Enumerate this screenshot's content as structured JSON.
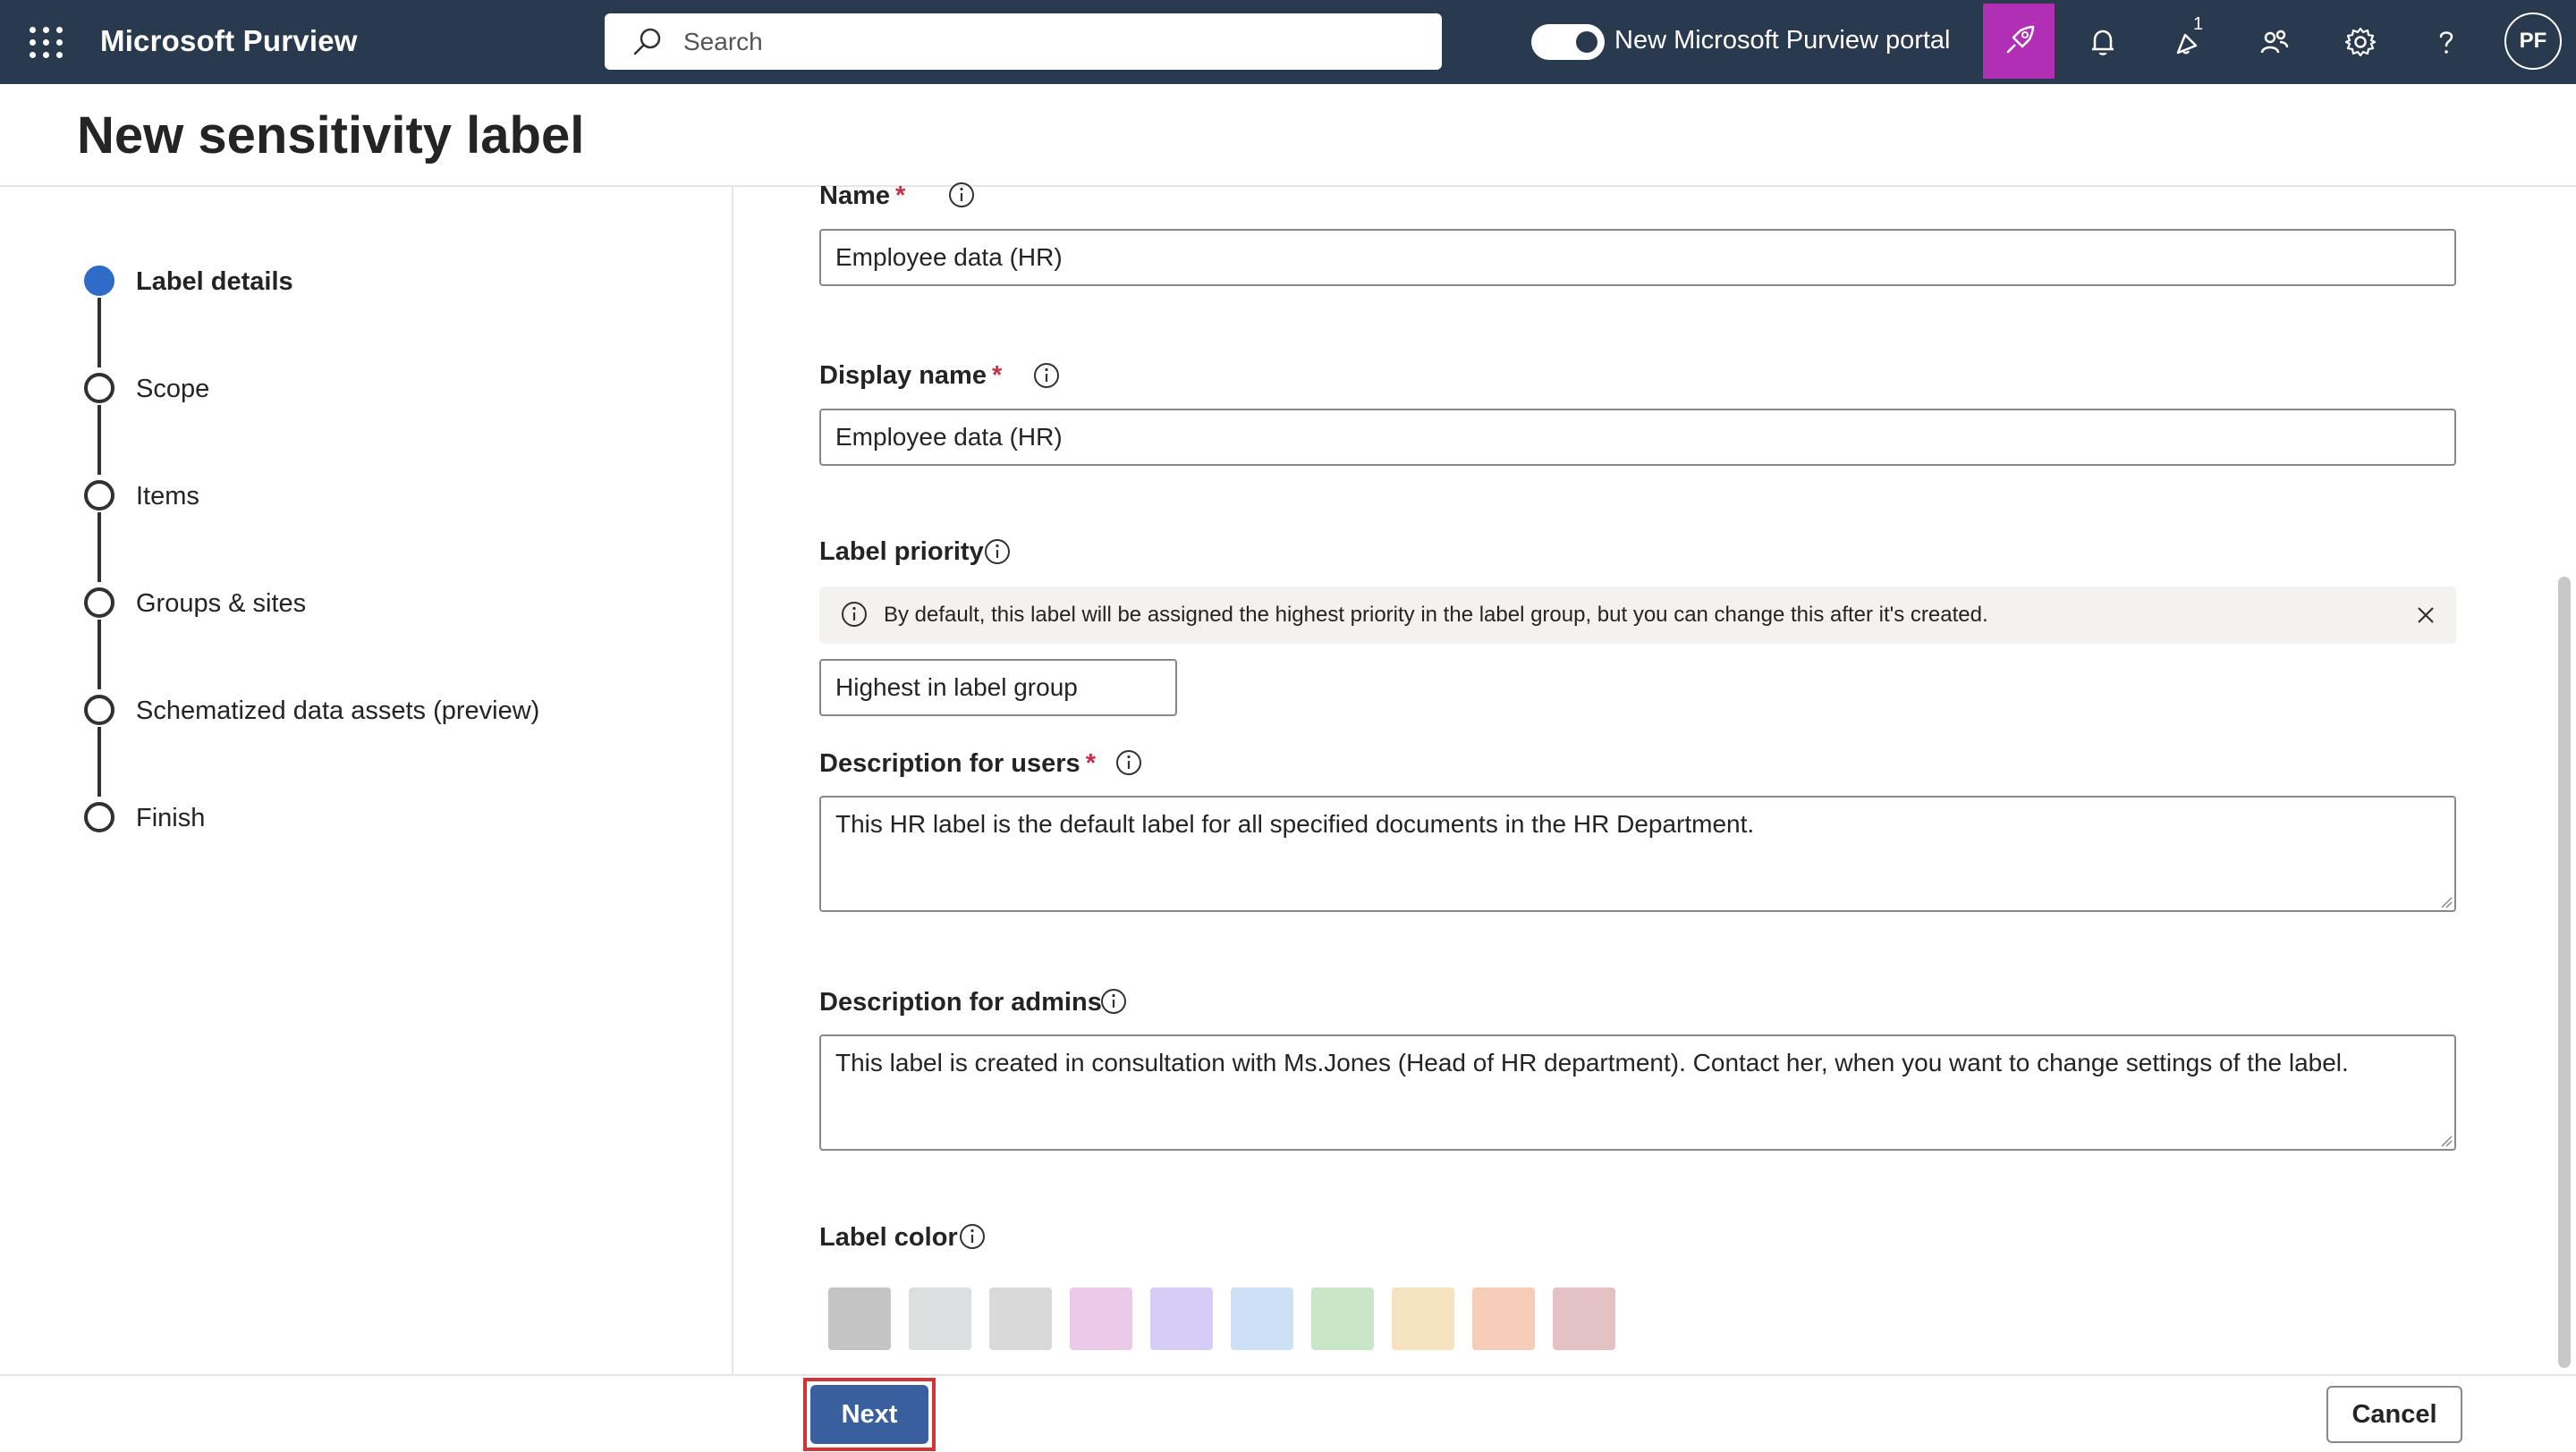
{
  "topbar": {
    "app_title": "Microsoft Purview",
    "search_placeholder": "Search",
    "portal_toggle_label": "New Microsoft Purview portal",
    "notification_badge": "1",
    "avatar_initials": "PF",
    "accent_color": "#b12fb5",
    "bar_color": "#2a3a4e"
  },
  "header": {
    "title": "New sensitivity label"
  },
  "steps": [
    {
      "label": "Label details",
      "state": "current"
    },
    {
      "label": "Scope",
      "state": "pending"
    },
    {
      "label": "Items",
      "state": "pending"
    },
    {
      "label": "Groups & sites",
      "state": "pending"
    },
    {
      "label": "Schematized data assets (preview)",
      "state": "pending"
    },
    {
      "label": "Finish",
      "state": "pending"
    }
  ],
  "form": {
    "name": {
      "label": "Name",
      "value": "Employee data (HR)"
    },
    "display_name": {
      "label": "Display name",
      "value": "Employee data (HR)"
    },
    "label_priority": {
      "label": "Label priority",
      "info_message": "By default, this label will be assigned the highest priority in the label group, but you can change this after it's created.",
      "value": "Highest in label group"
    },
    "description_users": {
      "label": "Description for users",
      "value": "This HR label is the default label for all specified documents in the HR Department."
    },
    "description_admins": {
      "label": "Description for admins",
      "value": "This label is created in consultation with Ms.Jones (Head of HR department). Contact her, when you want to change settings of the label."
    },
    "label_color": {
      "label": "Label color",
      "swatches": [
        "#c4c4c4",
        "#dcdfe0",
        "#d9d9d9",
        "#ecc9e8",
        "#d6cdf7",
        "#cde0f4",
        "#c9e6c7",
        "#f6e3bf",
        "#f6cdb9",
        "#e4c2c4"
      ]
    }
  },
  "footer": {
    "next_label": "Next",
    "cancel_label": "Cancel",
    "next_highlight_color": "#d13438"
  }
}
